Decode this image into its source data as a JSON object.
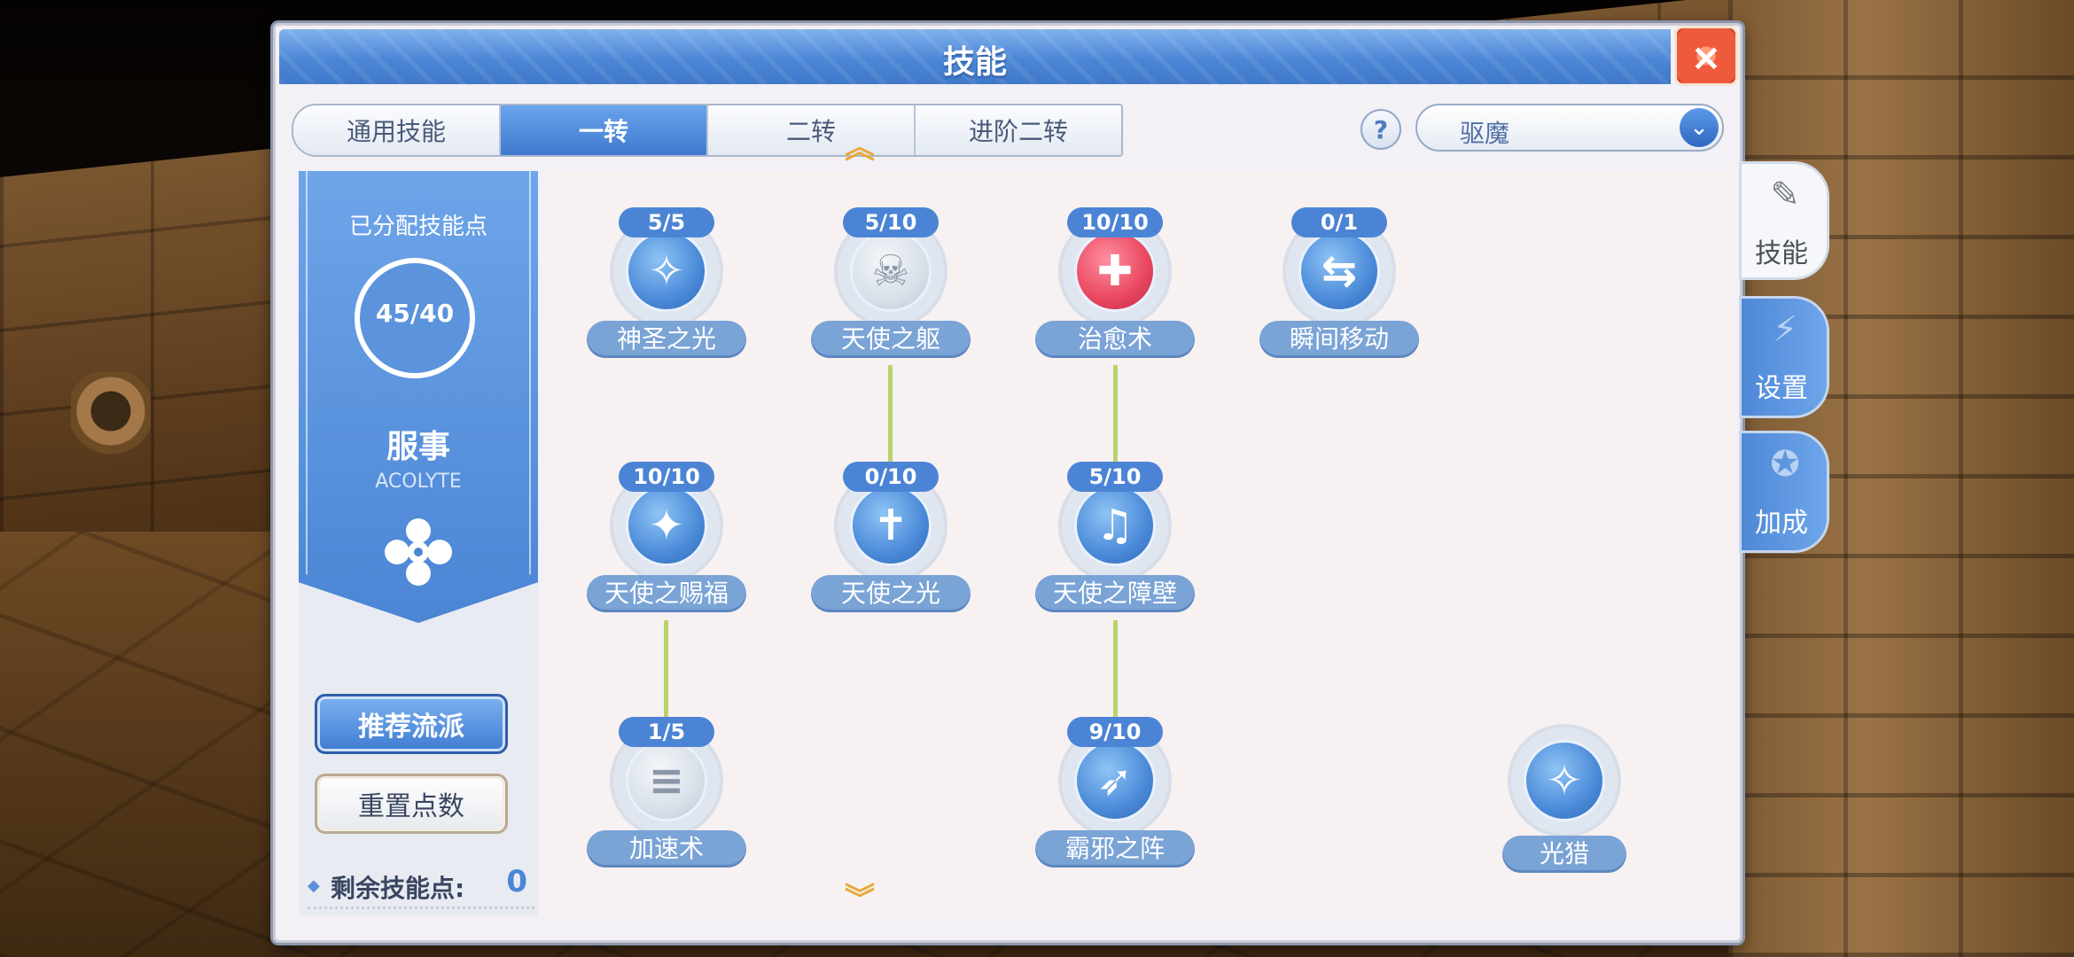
{
  "window": {
    "title": "技能",
    "close_icon": "×"
  },
  "tabs": [
    {
      "label": "通用技能",
      "active": false
    },
    {
      "label": "一转",
      "active": true
    },
    {
      "label": "二转",
      "active": false
    },
    {
      "label": "进阶二转",
      "active": false
    }
  ],
  "help_icon": "?",
  "class_select": {
    "value": "驱魔",
    "chevron": "⌄"
  },
  "sidebar": {
    "allocated_label": "已分配技能点",
    "allocated_value": "45/40",
    "job_name": "服事",
    "job_name_en": "ACOLYTE",
    "recommend_button": "推荐流派",
    "reset_button": "重置点数",
    "remaining_label": "剩余技能点:",
    "remaining_value": "0"
  },
  "scroll": {
    "up": "︽",
    "down": "︾"
  },
  "skills": [
    {
      "name": "神圣之光",
      "level": "5/5",
      "icon": "holy-light-icon",
      "style": "blue"
    },
    {
      "name": "天使之躯",
      "level": "5/10",
      "icon": "angel-body-icon",
      "style": "gray"
    },
    {
      "name": "治愈术",
      "level": "10/10",
      "icon": "heal-icon",
      "style": "red"
    },
    {
      "name": "瞬间移动",
      "level": "0/1",
      "icon": "teleport-icon",
      "style": "blue"
    },
    {
      "name": "天使之赐福",
      "level": "10/10",
      "icon": "blessing-icon",
      "style": "blue"
    },
    {
      "name": "天使之光",
      "level": "0/10",
      "icon": "angel-light-icon",
      "style": "blue"
    },
    {
      "name": "天使之障壁",
      "level": "5/10",
      "icon": "angel-barrier-icon",
      "style": "blue"
    },
    {
      "name": "加速术",
      "level": "1/5",
      "icon": "increase-agi-icon",
      "style": "gray"
    },
    {
      "name": "霸邪之阵",
      "level": "9/10",
      "icon": "pneuma-icon",
      "style": "blue"
    },
    {
      "name": "光猎",
      "level": "",
      "icon": "light-hunt-icon",
      "style": "blue"
    }
  ],
  "side_tabs": [
    {
      "label": "技能",
      "icon": "skill-book-icon",
      "active": true
    },
    {
      "label": "设置",
      "icon": "settings-bolt-icon",
      "active": false
    },
    {
      "label": "加成",
      "icon": "medal-icon",
      "active": false
    }
  ],
  "colors": {
    "accent": "#4b84d4",
    "connector": "#b9d36a",
    "scroll_arrow": "#e8a93a"
  }
}
